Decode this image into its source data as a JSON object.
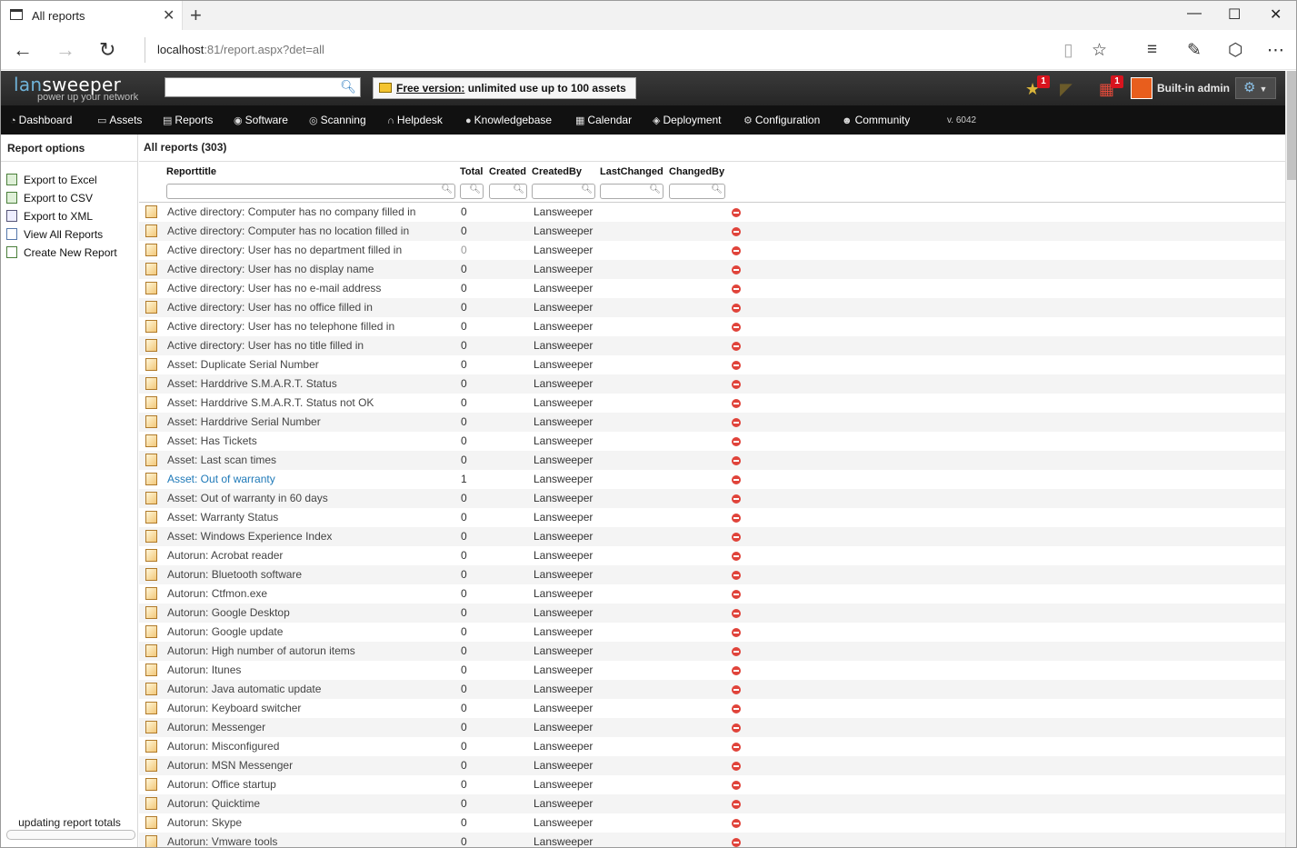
{
  "browser": {
    "tab_title": "All reports",
    "url_host": "localhost",
    "url_rest": ":81/report.aspx?det=all"
  },
  "header": {
    "logo_a": "lan",
    "logo_b": "sweeper",
    "tagline": "power up your network",
    "free_bold": "Free version:",
    "free_text": " unlimited use up to 100 assets",
    "star_badge": "1",
    "calendar_badge": "1",
    "user_name": "Built-in admin"
  },
  "nav": {
    "items": [
      {
        "label": "Dashboard",
        "icon": "dashboard-icon"
      },
      {
        "label": "Assets",
        "icon": "assets-icon"
      },
      {
        "label": "Reports",
        "icon": "reports-icon"
      },
      {
        "label": "Software",
        "icon": "software-icon"
      },
      {
        "label": "Scanning",
        "icon": "scanning-icon"
      },
      {
        "label": "Helpdesk",
        "icon": "helpdesk-icon"
      },
      {
        "label": "Knowledgebase",
        "icon": "knowledgebase-icon"
      },
      {
        "label": "Calendar",
        "icon": "calendar-icon"
      },
      {
        "label": "Deployment",
        "icon": "deployment-icon"
      },
      {
        "label": "Configuration",
        "icon": "configuration-icon"
      },
      {
        "label": "Community",
        "icon": "community-icon"
      }
    ],
    "version": "v. 6042"
  },
  "sidebar": {
    "title": "Report options",
    "options": [
      "Export to Excel",
      "Export to CSV",
      "Export to XML",
      "View All Reports",
      "Create New Report"
    ],
    "status": "updating report totals"
  },
  "content": {
    "title": "All reports (303)",
    "columns": {
      "title": "Reporttitle",
      "total": "Total",
      "created": "Created",
      "createdby": "CreatedBy",
      "lastchanged": "LastChanged",
      "changedby": "ChangedBy"
    },
    "rows": [
      {
        "title": "Active directory: Computer has no company filled in",
        "total": "0",
        "createdby": "Lansweeper"
      },
      {
        "title": "Active directory: Computer has no location filled in",
        "total": "0",
        "createdby": "Lansweeper"
      },
      {
        "title": "Active directory: User has no department filled in",
        "total": "0",
        "createdby": "Lansweeper"
      },
      {
        "title": "Active directory: User has no display name",
        "total": "0",
        "createdby": "Lansweeper"
      },
      {
        "title": "Active directory: User has no e-mail address",
        "total": "0",
        "createdby": "Lansweeper"
      },
      {
        "title": "Active directory: User has no office filled in",
        "total": "0",
        "createdby": "Lansweeper"
      },
      {
        "title": "Active directory: User has no telephone filled in",
        "total": "0",
        "createdby": "Lansweeper"
      },
      {
        "title": "Active directory: User has no title filled in",
        "total": "0",
        "createdby": "Lansweeper"
      },
      {
        "title": "Asset: Duplicate Serial Number",
        "total": "0",
        "createdby": "Lansweeper"
      },
      {
        "title": "Asset: Harddrive S.M.A.R.T. Status",
        "total": "0",
        "createdby": "Lansweeper"
      },
      {
        "title": "Asset: Harddrive S.M.A.R.T. Status not OK",
        "total": "0",
        "createdby": "Lansweeper"
      },
      {
        "title": "Asset: Harddrive Serial Number",
        "total": "0",
        "createdby": "Lansweeper"
      },
      {
        "title": "Asset: Has Tickets",
        "total": "0",
        "createdby": "Lansweeper"
      },
      {
        "title": "Asset: Last scan times",
        "total": "0",
        "createdby": "Lansweeper"
      },
      {
        "title": "Asset: Out of warranty",
        "total": "1",
        "createdby": "Lansweeper"
      },
      {
        "title": "Asset: Out of warranty in 60 days",
        "total": "0",
        "createdby": "Lansweeper"
      },
      {
        "title": "Asset: Warranty Status",
        "total": "0",
        "createdby": "Lansweeper"
      },
      {
        "title": "Asset: Windows Experience Index",
        "total": "0",
        "createdby": "Lansweeper"
      },
      {
        "title": "Autorun: Acrobat reader",
        "total": "0",
        "createdby": "Lansweeper"
      },
      {
        "title": "Autorun: Bluetooth software",
        "total": "0",
        "createdby": "Lansweeper"
      },
      {
        "title": "Autorun: Ctfmon.exe",
        "total": "0",
        "createdby": "Lansweeper"
      },
      {
        "title": "Autorun: Google Desktop",
        "total": "0",
        "createdby": "Lansweeper"
      },
      {
        "title": "Autorun: Google update",
        "total": "0",
        "createdby": "Lansweeper"
      },
      {
        "title": "Autorun: High number of autorun items",
        "total": "0",
        "createdby": "Lansweeper"
      },
      {
        "title": "Autorun: Itunes",
        "total": "0",
        "createdby": "Lansweeper"
      },
      {
        "title": "Autorun: Java automatic update",
        "total": "0",
        "createdby": "Lansweeper"
      },
      {
        "title": "Autorun: Keyboard switcher",
        "total": "0",
        "createdby": "Lansweeper"
      },
      {
        "title": "Autorun: Messenger",
        "total": "0",
        "createdby": "Lansweeper"
      },
      {
        "title": "Autorun: Misconfigured",
        "total": "0",
        "createdby": "Lansweeper"
      },
      {
        "title": "Autorun: MSN Messenger",
        "total": "0",
        "createdby": "Lansweeper"
      },
      {
        "title": "Autorun: Office startup",
        "total": "0",
        "createdby": "Lansweeper"
      },
      {
        "title": "Autorun: Quicktime",
        "total": "0",
        "createdby": "Lansweeper"
      },
      {
        "title": "Autorun: Skype",
        "total": "0",
        "createdby": "Lansweeper"
      },
      {
        "title": "Autorun: Vmware tools",
        "total": "0",
        "createdby": "Lansweeper"
      }
    ]
  }
}
